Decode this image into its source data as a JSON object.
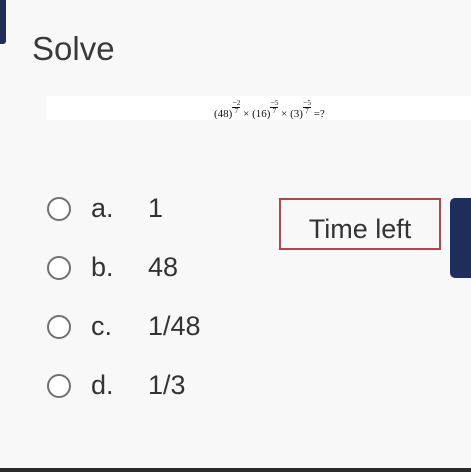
{
  "question": {
    "title": "Solve",
    "equation": {
      "base1": "(48)",
      "exp1_sign": "−",
      "exp1_num": "2",
      "exp1_den": "7",
      "times1": " × ",
      "base2": "(16)",
      "exp2_sign": "−",
      "exp2_num": "5",
      "exp2_den": "7",
      "times2": " × ",
      "base3": "(3)",
      "exp3_sign": "−",
      "exp3_num": "5",
      "exp3_den": "7",
      "tail": " =?"
    }
  },
  "options": [
    {
      "letter": "a.",
      "value": "1"
    },
    {
      "letter": "b.",
      "value": "48"
    },
    {
      "letter": "c.",
      "value": "1/48"
    },
    {
      "letter": "d.",
      "value": "1/3"
    }
  ],
  "timer": {
    "label": "Time left"
  },
  "colors": {
    "accent": "#1e2d5a",
    "timer_border": "#b2464f",
    "background": "#f8f8f8"
  }
}
